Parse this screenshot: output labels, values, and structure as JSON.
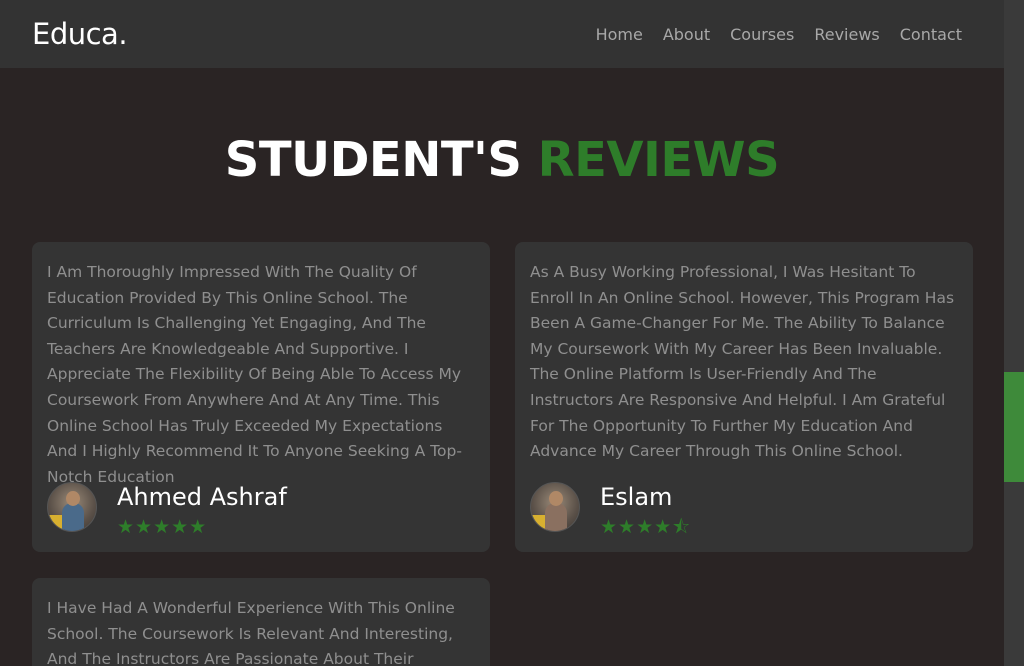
{
  "nav": {
    "logo": "Educa.",
    "links": [
      "Home",
      "About",
      "Courses",
      "Reviews",
      "Contact"
    ]
  },
  "section": {
    "heading_main": "STUDENT'S",
    "heading_accent": "REVIEWS"
  },
  "reviews": [
    {
      "text": "I Am Thoroughly Impressed With The Quality Of Education Provided By This Online School. The Curriculum Is Challenging Yet Engaging, And The Teachers Are Knowledgeable And Supportive. I Appreciate The Flexibility Of Being Able To Access My Coursework From Anywhere And At Any Time. This Online School Has Truly Exceeded My Expectations And I Highly Recommend It To Anyone Seeking A Top-Notch Education",
      "name": "Ahmed Ashraf",
      "rating": 5,
      "stars": "★★★★★"
    },
    {
      "text": "As A Busy Working Professional, I Was Hesitant To Enroll In An Online School. However, This Program Has Been A Game-Changer For Me. The Ability To Balance My Coursework With My Career Has Been Invaluable. The Online Platform Is User-Friendly And The Instructors Are Responsive And Helpful. I Am Grateful For The Opportunity To Further My Education And Advance My Career Through This Online School.",
      "name": "Eslam",
      "rating": 4.5,
      "stars": "★★★★⯪"
    },
    {
      "text": "I Have Had A Wonderful Experience With This Online School. The Coursework Is Relevant And Interesting, And The Instructors Are Passionate About Their Subjects. The Online"
    }
  ],
  "colors": {
    "background": "#2a2424",
    "navbar": "#333333",
    "card": "#343434",
    "accent": "#2e7d2a",
    "scrollbar_thumb": "#3e8a3a"
  }
}
